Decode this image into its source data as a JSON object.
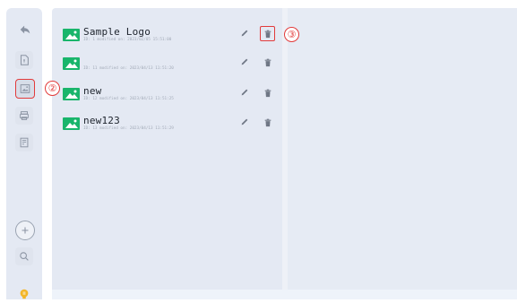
{
  "sidebar": {
    "items": [
      {
        "name": "back",
        "icon": "back-arrow-icon"
      },
      {
        "name": "file",
        "icon": "document-icon"
      },
      {
        "name": "image",
        "icon": "image-icon",
        "selected": true
      },
      {
        "name": "printer",
        "icon": "printer-icon"
      },
      {
        "name": "template",
        "icon": "template-icon"
      },
      {
        "name": "add",
        "icon": "plus-circle-icon"
      },
      {
        "name": "search",
        "icon": "search-icon"
      },
      {
        "name": "tip",
        "icon": "lightbulb-icon"
      }
    ]
  },
  "callouts": {
    "step2": "②",
    "step3": "③"
  },
  "images": [
    {
      "name": "Sample Logo",
      "meta": "ID: 1  modified on: 2023/02/05 15:51:00",
      "icon": "image-thumbnail-icon"
    },
    {
      "name": "",
      "meta": "ID: 11  modified on: 2023/04/13 11:51:20",
      "icon": "image-thumbnail-icon"
    },
    {
      "name": "new",
      "meta": "ID: 12  modified on: 2023/04/13 11:51:25",
      "icon": "image-thumbnail-icon"
    },
    {
      "name": "new123",
      "meta": "ID: 13  modified on: 2023/04/13 11:51:29",
      "icon": "image-thumbnail-icon"
    }
  ],
  "colors": {
    "accent_red": "#e23b3b",
    "thumb_green": "#19b56b",
    "panel_bg": "#e4e9f3"
  }
}
